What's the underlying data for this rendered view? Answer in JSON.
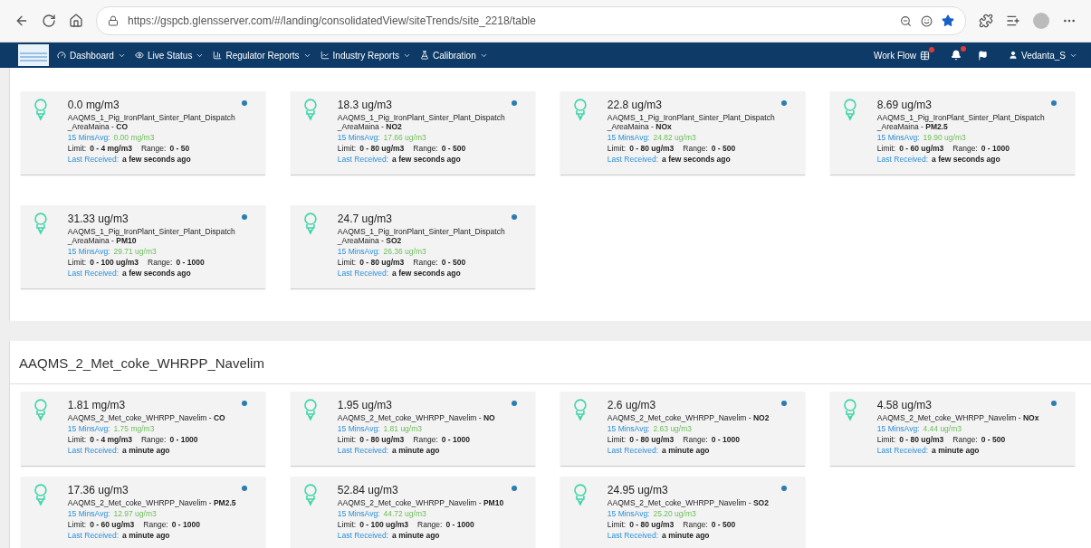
{
  "browser": {
    "url": "https://gspcb.glensserver.com/#/landing/consolidatedView/siteTrends/site_2218/table"
  },
  "nav": {
    "menus": [
      {
        "label": "Dashboard"
      },
      {
        "label": "Live Status"
      },
      {
        "label": "Regulator Reports"
      },
      {
        "label": "Industry Reports"
      },
      {
        "label": "Calibration"
      }
    ],
    "workflow": "Work Flow",
    "user": "Vedanta_S"
  },
  "sections": [
    {
      "cards": [
        {
          "reading": "0.0 mg/m3",
          "station": "AAQMS_1_Pig_IronPlant_Sinter_Plant_Dispatch _AreaMaina - **CO**",
          "avg_label": "15 MinsAvg:",
          "avg": "0.00  mg/m3",
          "limit_label": "Limit:",
          "limit": "0 - 4  mg/m3",
          "range_label": "Range:",
          "range": "0 - 50",
          "received_label": "Last Received:",
          "received": "a few seconds ago"
        },
        {
          "reading": "18.3 ug/m3",
          "station": "AAQMS_1_Pig_IronPlant_Sinter_Plant_Dispatch _AreaMaina - **NO2**",
          "avg_label": "15 MinsAvg:",
          "avg": "17.66  ug/m3",
          "limit_label": "Limit:",
          "limit": "0 - 80  ug/m3",
          "range_label": "Range:",
          "range": "0 - 500",
          "received_label": "Last Received:",
          "received": "a few seconds ago"
        },
        {
          "reading": "22.8 ug/m3",
          "station": "AAQMS_1_Pig_IronPlant_Sinter_Plant_Dispatch _AreaMaina - **NOx**",
          "avg_label": "15 MinsAvg:",
          "avg": "24.82  ug/m3",
          "limit_label": "Limit:",
          "limit": "0 - 80  ug/m3",
          "range_label": "Range:",
          "range": "0 - 500",
          "received_label": "Last Received:",
          "received": "a few seconds ago"
        },
        {
          "reading": "8.69 ug/m3",
          "station": "AAQMS_1_Pig_IronPlant_Sinter_Plant_Dispatch _AreaMaina - **PM2.5**",
          "avg_label": "15 MinsAvg:",
          "avg": "19.90  ug/m3",
          "limit_label": "Limit:",
          "limit": "0 - 60  ug/m3",
          "range_label": "Range:",
          "range": "0 - 1000",
          "received_label": "Last Received:",
          "received": "a few seconds ago"
        },
        {
          "reading": "31.33 ug/m3",
          "station": "AAQMS_1_Pig_IronPlant_Sinter_Plant_Dispatch _AreaMaina - **PM10**",
          "avg_label": "15 MinsAvg:",
          "avg": "29.71  ug/m3",
          "limit_label": "Limit:",
          "limit": "0 - 100  ug/m3",
          "range_label": "Range:",
          "range": "0 - 1000",
          "received_label": "Last Received:",
          "received": "a few seconds ago"
        },
        {
          "reading": "24.7 ug/m3",
          "station": "AAQMS_1_Pig_IronPlant_Sinter_Plant_Dispatch _AreaMaina - **SO2**",
          "avg_label": "15 MinsAvg:",
          "avg": "26.36  ug/m3",
          "limit_label": "Limit:",
          "limit": "0 - 80  ug/m3",
          "range_label": "Range:",
          "range": "0 - 500",
          "received_label": "Last Received:",
          "received": "a few seconds ago"
        }
      ]
    },
    {
      "title": "AAQMS_2_Met_coke_WHRPP_Navelim",
      "cards": [
        {
          "reading": "1.81 mg/m3",
          "station": "AAQMS_2_Met_coke_WHRPP_Navelim - **CO**",
          "avg_label": "15 MinsAvg:",
          "avg": "1.75  mg/m3",
          "limit_label": "Limit:",
          "limit": "0 - 4  mg/m3",
          "range_label": "Range:",
          "range": "0 - 1000",
          "received_label": "Last Received:",
          "received": "a minute ago"
        },
        {
          "reading": "1.95 ug/m3",
          "station": "AAQMS_2_Met_coke_WHRPP_Navelim - **NO**",
          "avg_label": "15 MinsAvg:",
          "avg": "1.81  ug/m3",
          "limit_label": "Limit:",
          "limit": "0 - 80  ug/m3",
          "range_label": "Range:",
          "range": "0 - 1000",
          "received_label": "Last Received:",
          "received": "a minute ago"
        },
        {
          "reading": "2.6 ug/m3",
          "station": "AAQMS_2_Met_coke_WHRPP_Navelim - **NO2**",
          "avg_label": "15 MinsAvg:",
          "avg": "2.63  ug/m3",
          "limit_label": "Limit:",
          "limit": "0 - 80  ug/m3",
          "range_label": "Range:",
          "range": "0 - 1000",
          "received_label": "Last Received:",
          "received": "a minute ago"
        },
        {
          "reading": "4.58 ug/m3",
          "station": "AAQMS_2_Met_coke_WHRPP_Navelim - **NOx**",
          "avg_label": "15 MinsAvg:",
          "avg": "4.44  ug/m3",
          "limit_label": "Limit:",
          "limit": "0 - 80  ug/m3",
          "range_label": "Range:",
          "range": "0 - 500",
          "received_label": "Last Received:",
          "received": "a minute ago"
        },
        {
          "reading": "17.36 ug/m3",
          "station": "AAQMS_2_Met_coke_WHRPP_Navelim - **PM2.5**",
          "avg_label": "15 MinsAvg:",
          "avg": "12.97  ug/m3",
          "limit_label": "Limit:",
          "limit": "0 - 60  ug/m3",
          "range_label": "Range:",
          "range": "0 - 1000",
          "received_label": "Last Received:",
          "received": "a minute ago"
        },
        {
          "reading": "52.84 ug/m3",
          "station": "AAQMS_2_Met_coke_WHRPP_Navelim - **PM10**",
          "avg_label": "15 MinsAvg:",
          "avg": "44.72  ug/m3",
          "limit_label": "Limit:",
          "limit": "0 - 100  ug/m3",
          "range_label": "Range:",
          "range": "0 - 1000",
          "received_label": "Last Received:",
          "received": "a minute ago"
        },
        {
          "reading": "24.95 ug/m3",
          "station": "AAQMS_2_Met_coke_WHRPP_Navelim - **SO2**",
          "avg_label": "15 MinsAvg:",
          "avg": "25.20  ug/m3",
          "limit_label": "Limit:",
          "limit": "0 - 80  ug/m3",
          "range_label": "Range:",
          "range": "0 - 500",
          "received_label": "Last Received:",
          "received": "a minute ago"
        }
      ]
    }
  ]
}
